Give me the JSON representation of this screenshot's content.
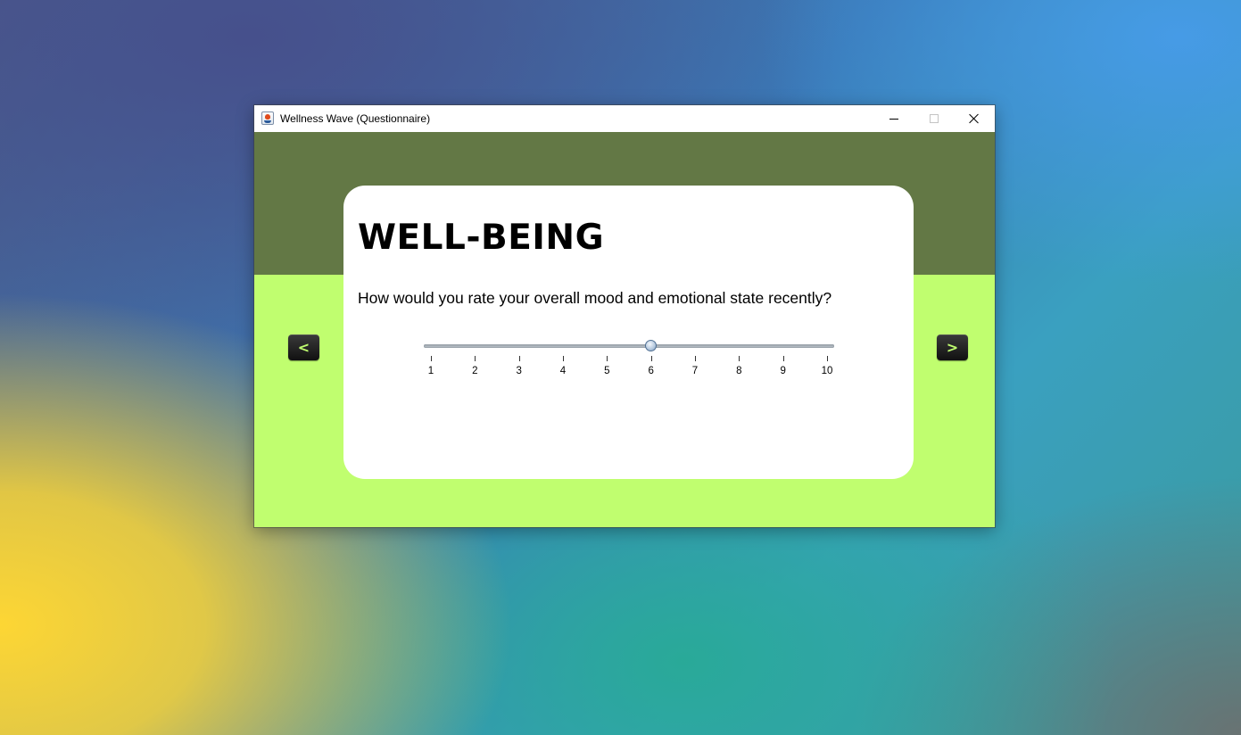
{
  "window": {
    "title": "Wellness Wave (Questionnaire)",
    "controls": [
      "minimize-icon",
      "maximize-icon",
      "close-icon"
    ]
  },
  "card": {
    "heading": "WELL-BEING",
    "question": "How would you rate your overall mood and emotional state recently?"
  },
  "slider": {
    "min": 1,
    "max": 10,
    "value": 6,
    "tick_labels": [
      "1",
      "2",
      "3",
      "4",
      "5",
      "6",
      "7",
      "8",
      "9",
      "10"
    ]
  },
  "nav": {
    "prev_label": "<",
    "next_label": ">"
  },
  "colors": {
    "header_band": "#637845",
    "background_accent": "#c0fe6f",
    "nav_button": "#1a1a1a",
    "nav_glyph": "#c0fe6f",
    "card": "#ffffff"
  }
}
